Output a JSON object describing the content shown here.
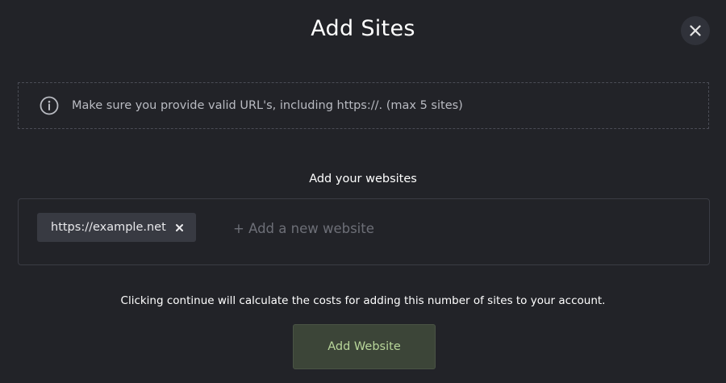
{
  "modal": {
    "title": "Add Sites",
    "close_icon": "close-icon"
  },
  "notice": {
    "icon": "info-icon",
    "text": "Make sure you provide valid URL's, including https://. (max 5 sites)"
  },
  "sites": {
    "label": "Add your websites",
    "chips": [
      {
        "label": "https://example.net",
        "remove_icon": "remove-x-icon"
      }
    ],
    "input": {
      "placeholder": "+ Add a new website",
      "value": ""
    }
  },
  "footer": {
    "hint": "Clicking continue will calculate the costs for adding this number of sites to your account.",
    "button_label": "Add Website"
  },
  "colors": {
    "background": "#222328",
    "accent_button_bg": "#3c4538",
    "accent_button_text": "#b8d69a",
    "chip_bg": "#383a42"
  }
}
